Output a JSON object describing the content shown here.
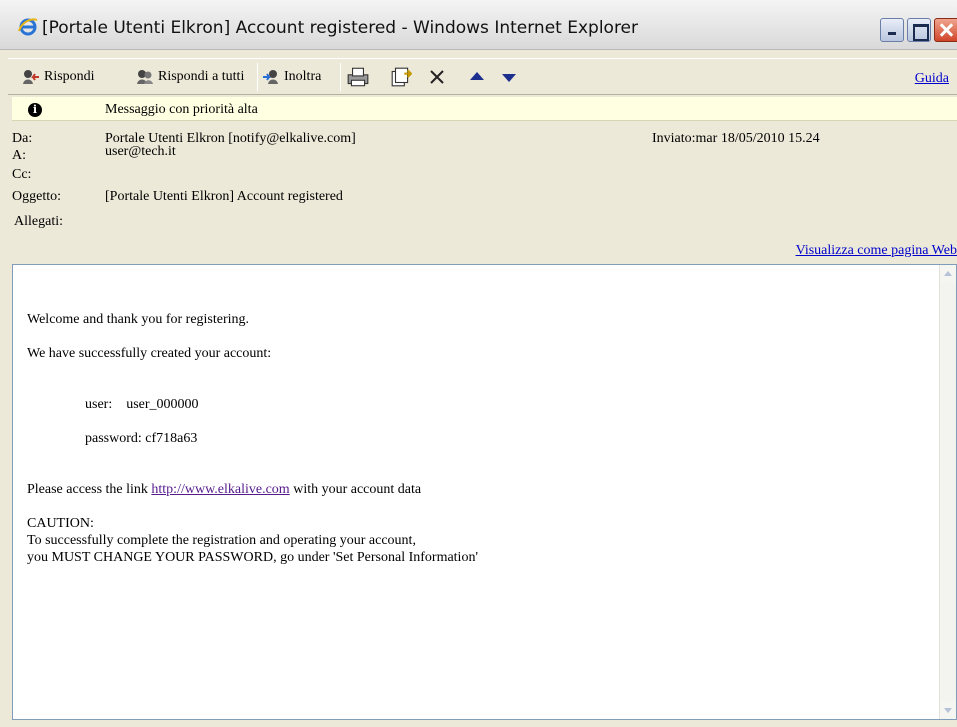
{
  "window": {
    "title": "[Portale Utenti Elkron] Account registered - Windows Internet Explorer"
  },
  "toolbar": {
    "reply_label": "Rispondi",
    "reply_all_label": "Rispondi a tutti",
    "forward_label": "Inoltra",
    "help_label": "Guida",
    "icons": [
      "reply-icon",
      "reply-all-icon",
      "forward-icon",
      "print-icon",
      "move-icon",
      "delete-icon",
      "previous-arrow-icon",
      "next-arrow-icon"
    ]
  },
  "header": {
    "priority_text": "Messaggio con priorità alta",
    "from_label": "Da:",
    "from_value": "Portale Utenti Elkron [notify@elkalive.com]",
    "to_label": "A:",
    "to_value": "user@tech.it",
    "cc_label": "Cc:",
    "subject_label": "Oggetto:",
    "subject_value": "[Portale Utenti Elkron] Account registered",
    "attachments_label": "Allegati:",
    "sent_label": "Inviato:",
    "sent_value": "mar 18/05/2010 15.24",
    "web_view_link": "Visualizza come pagina Web"
  },
  "body": {
    "welcome": "Welcome and thank you for registering.",
    "created": "We have successfully created your account:",
    "user_line": "user:    user_000000",
    "password_line": "password: cf718a63",
    "access_prefix": "Please access the link ",
    "access_link": "http://www.elkalive.com",
    "access_suffix": " with your account data",
    "caution_title": "CAUTION:",
    "caution_line1": "To successfully complete the registration and operating your account,",
    "caution_line2": "you MUST CHANGE YOUR PASSWORD, go under 'Set Personal Information'"
  }
}
